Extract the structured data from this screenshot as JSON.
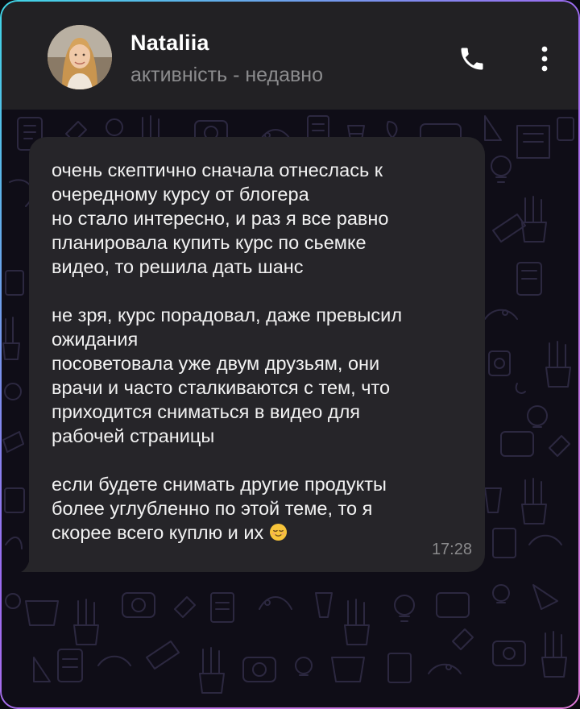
{
  "contact": {
    "name": "Nataliia",
    "status": "активність - недавно"
  },
  "header": {
    "call_icon": "phone-icon",
    "menu_icon": "more-vertical-icon"
  },
  "message": {
    "paragraphs": [
      "очень скептично сначала отнеслась к\nочередному курсу от блогера\nно стало интересно, и раз я все равно\nпланировала купить курс по сьемке\nвидео, то решила дать шанс",
      "не зря, курс порадовал, даже превысил\nожидания\nпосоветовала уже двум друзьям, они\nврачи и часто сталкиваются с тем, что\nприходится сниматься в видео для\nрабочей страницы",
      "если будете снимать другие продукты\nболее углубленно по этой теме, то я\nскорее всего куплю и их"
    ],
    "emoji": "relieved-face-emoji",
    "time": "17:28"
  },
  "colors": {
    "header_bg": "#222124",
    "chat_bg": "#0f0d17",
    "bubble_bg": "#262529",
    "text": "#f2f2f2",
    "muted": "#8c8c8e",
    "frame_gradient": [
      "#3fd6e6",
      "#9b6bf0",
      "#e07ad8"
    ]
  }
}
